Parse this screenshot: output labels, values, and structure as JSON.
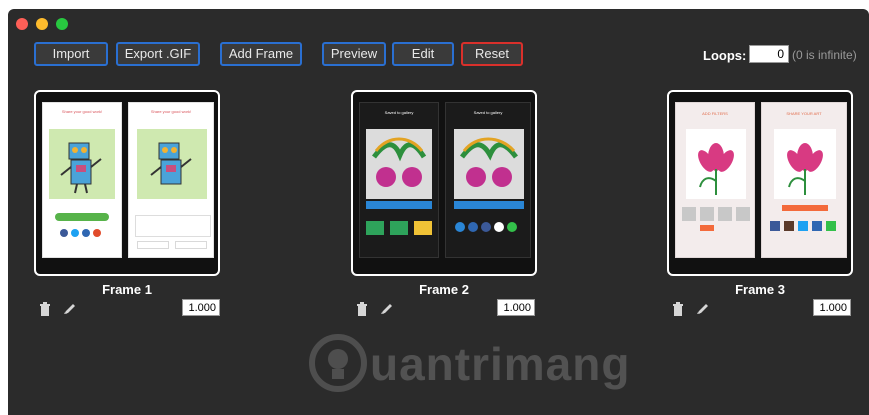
{
  "toolbar": {
    "import_label": "Import",
    "export_gif_label": "Export .GIF",
    "add_frame_label": "Add Frame",
    "preview_label": "Preview",
    "edit_label": "Edit",
    "reset_label": "Reset"
  },
  "loops": {
    "label": "Loops:",
    "value": "0",
    "hint": "(0 is infinite)"
  },
  "frames": [
    {
      "label": "Frame 1",
      "duration": "1.000",
      "thumb_title": "Share your good work!",
      "thumb_title_2": "Share your good work!"
    },
    {
      "label": "Frame 2",
      "duration": "1.000",
      "thumb_title": "Saved to gallery",
      "thumb_title_2": "Saved to gallery"
    },
    {
      "label": "Frame 3",
      "duration": "1.000",
      "thumb_title": "ADD FILTERS",
      "thumb_title_2": "SHARE YOUR ART"
    }
  ],
  "watermark": {
    "text": "uantrimang"
  },
  "colors": {
    "window_bg": "#2b2b2b",
    "button_border_blue": "#2a6fd1",
    "reset_border_red": "#d9302b"
  }
}
